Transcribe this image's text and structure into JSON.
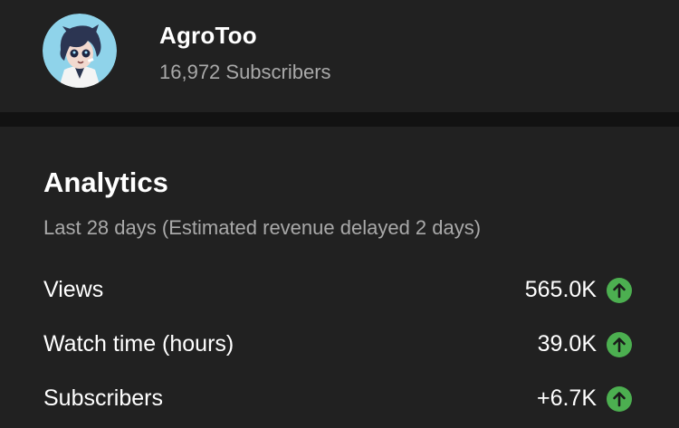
{
  "channel": {
    "name": "AgroToo",
    "subscribers": "16,972 Subscribers",
    "avatar_icon": "channel-avatar"
  },
  "analytics": {
    "title": "Analytics",
    "subtitle": "Last 28 days (Estimated revenue delayed 2 days)",
    "metrics": [
      {
        "label": "Views",
        "value": "565.0K",
        "trend": "up"
      },
      {
        "label": "Watch time (hours)",
        "value": "39.0K",
        "trend": "up"
      },
      {
        "label": "Subscribers",
        "value": "+6.7K",
        "trend": "up"
      }
    ]
  },
  "colors": {
    "background": "#212121",
    "divider": "#121212",
    "secondary_text": "#a9a9a9",
    "trend_up": "#4caf50",
    "avatar_background": "#8fd3ea"
  }
}
